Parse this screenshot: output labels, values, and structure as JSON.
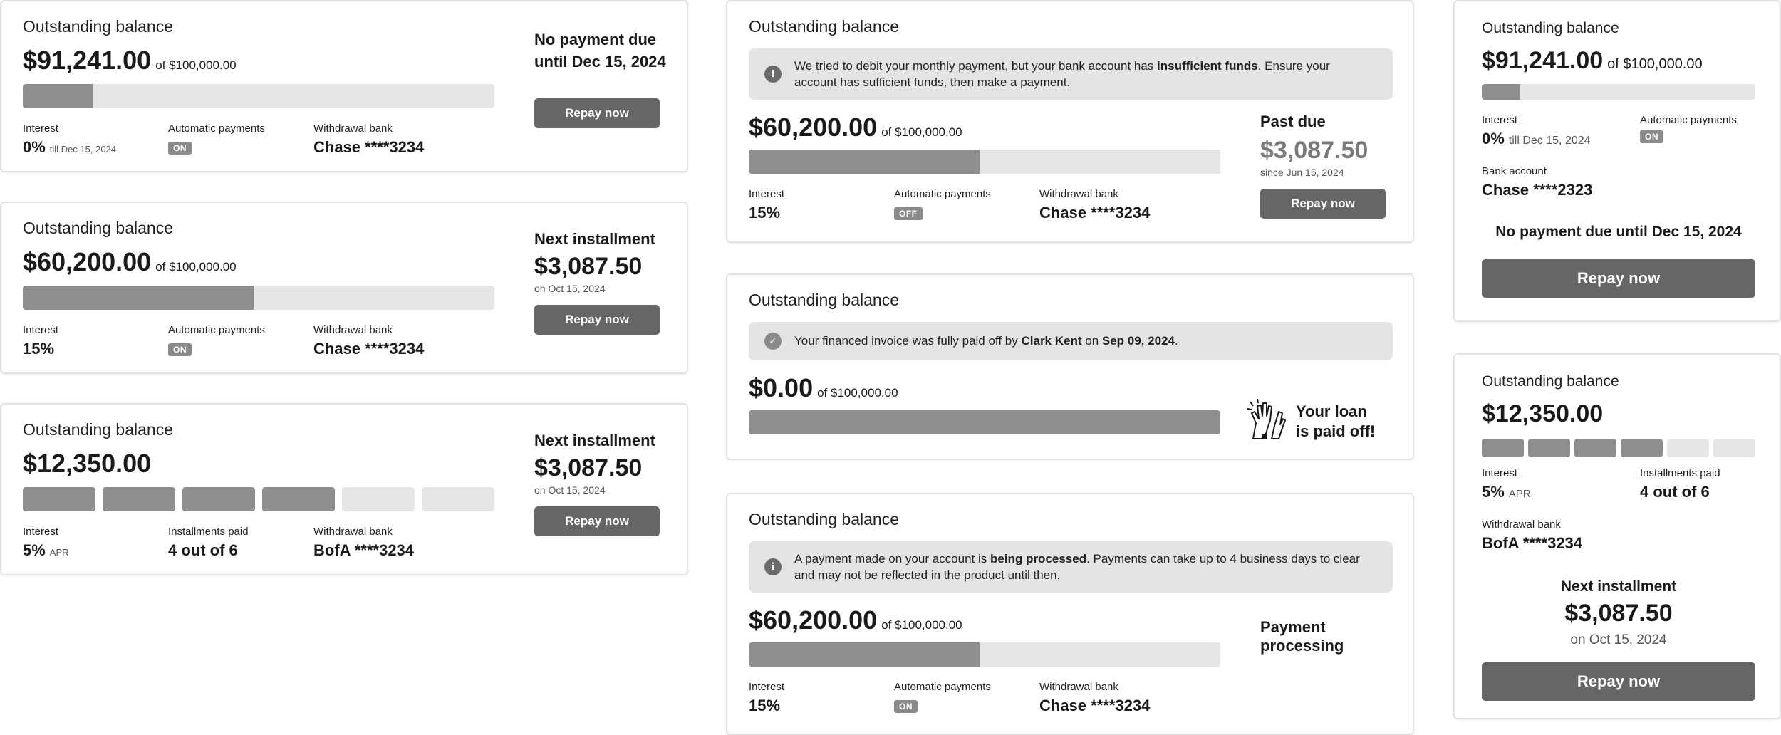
{
  "common": {
    "outstanding_balance": "Outstanding balance",
    "of_limit": "of $100,000.00",
    "interest": "Interest",
    "automatic_payments": "Automatic payments",
    "withdrawal_bank": "Withdrawal bank",
    "bank_account": "Bank account",
    "installments_paid": "Installments paid",
    "repay_now": "Repay now",
    "on": "ON",
    "off": "OFF",
    "apr": "APR"
  },
  "card1": {
    "amount": "$91,241.00",
    "progress_fraction": 0.15,
    "interest": "0%",
    "interest_note": "till Dec 15, 2024",
    "bank": "Chase ****3234",
    "heading": "No payment due until Dec 15, 2024"
  },
  "card2": {
    "amount": "$60,200.00",
    "progress_fraction": 0.49,
    "interest": "15%",
    "bank": "Chase ****3234",
    "heading": "Next installment",
    "installment": "$3,087.50",
    "date": "on Oct 15, 2024"
  },
  "card3": {
    "amount": "$12,350.00",
    "segments_total": 6,
    "segments_paid": 4,
    "interest": "5%",
    "installments": "4 out of 6",
    "bank": "BofA ****3234",
    "heading": "Next installment",
    "installment": "$3,087.50",
    "date": "on Oct 15, 2024"
  },
  "card4": {
    "notice_pre": "We tried to debit your monthly payment, but your bank account has ",
    "notice_bold": "insufficient funds",
    "notice_post": ". Ensure your account has sufficient funds, then make a payment.",
    "amount": "$60,200.00",
    "progress_fraction": 0.49,
    "interest": "15%",
    "bank": "Chase ****3234",
    "heading": "Past due",
    "past_due_amount": "$3,087.50",
    "since": "since Jun 15, 2024"
  },
  "card5": {
    "notice_pre": "Your financed invoice was fully paid off by ",
    "notice_name": "Clark Kent",
    "notice_mid": " on ",
    "notice_date": "Sep 09, 2024",
    "notice_end": ".",
    "amount": "$0.00",
    "progress_fraction": 1.0,
    "paid_off_line1": "Your loan",
    "paid_off_line2": "is paid off!"
  },
  "card6": {
    "notice_pre": "A payment made on your account is ",
    "notice_bold": "being processed",
    "notice_post": ". Payments can take up to 4 business days to clear and may not be reflected in the product until then.",
    "amount": "$60,200.00",
    "progress_fraction": 0.49,
    "interest": "15%",
    "bank": "Chase ****3234",
    "status_line1": "Payment",
    "status_line2": "processing"
  },
  "card7": {
    "amount": "$91,241.00",
    "progress_fraction": 0.14,
    "interest": "0%",
    "interest_note": "till Dec 15, 2024",
    "bank": "Chase ****2323",
    "heading": "No payment due until Dec 15, 2024"
  },
  "card8": {
    "amount": "$12,350.00",
    "segments_total": 6,
    "segments_paid": 4,
    "interest": "5%",
    "installments": "4 out of 6",
    "bank": "BofA ****3234",
    "heading": "Next installment",
    "installment": "$3,087.50",
    "date": "on Oct 15, 2024"
  }
}
